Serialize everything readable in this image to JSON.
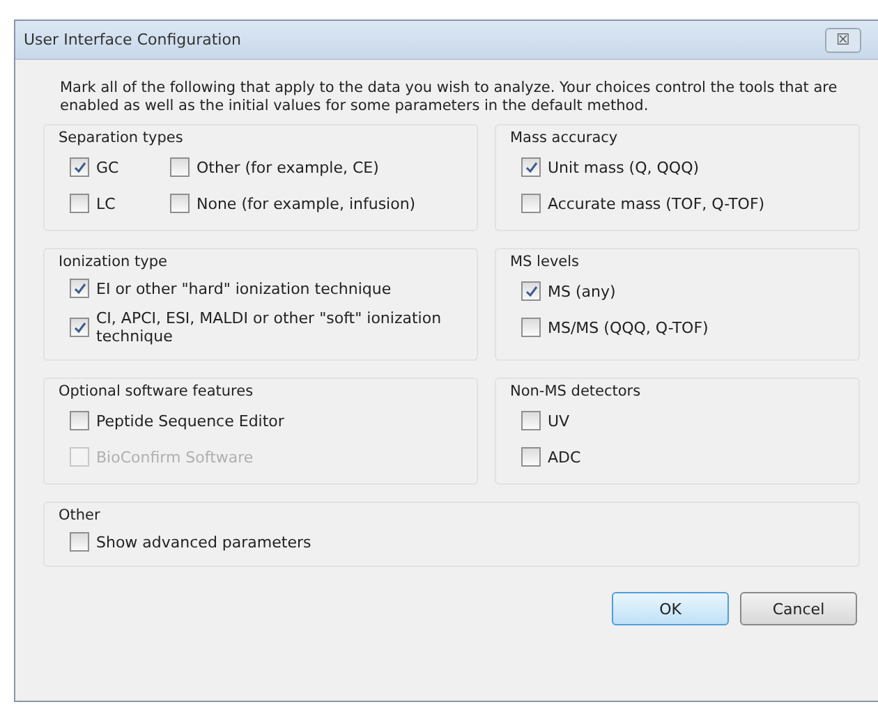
{
  "window": {
    "title": "User Interface Configuration",
    "close": "☒"
  },
  "intro": "Mark all of the following that apply to the data you wish to analyze. Your choices control the tools that are enabled as well as the initial values for some parameters in the default method.",
  "rows": [
    [
      {
        "title": "Separation types",
        "kind": "grid",
        "items": [
          {
            "label": "GC",
            "checked": true,
            "disabled": false
          },
          {
            "label": "Other (for example, CE)",
            "checked": false,
            "disabled": false
          },
          {
            "label": "LC",
            "checked": false,
            "disabled": false
          },
          {
            "label": "None (for example, infusion)",
            "checked": false,
            "disabled": false
          }
        ]
      },
      {
        "title": "Mass accuracy",
        "kind": "list",
        "items": [
          {
            "label": "Unit mass  (Q, QQQ)",
            "checked": true,
            "disabled": false
          },
          {
            "label": "Accurate mass  (TOF, Q-TOF)",
            "checked": false,
            "disabled": false
          }
        ]
      }
    ],
    [
      {
        "title": "Ionization type",
        "kind": "list",
        "items": [
          {
            "label": "EI or other \"hard\" ionization technique",
            "checked": true,
            "disabled": false
          },
          {
            "label": "CI, APCI, ESI, MALDI or other \"soft\" ionization technique",
            "checked": true,
            "disabled": false
          }
        ]
      },
      {
        "title": "MS levels",
        "kind": "list",
        "items": [
          {
            "label": "MS  (any)",
            "checked": true,
            "disabled": false
          },
          {
            "label": "MS/MS  (QQQ, Q-TOF)",
            "checked": false,
            "disabled": false
          }
        ]
      }
    ],
    [
      {
        "title": "Optional software features",
        "kind": "list",
        "items": [
          {
            "label": "Peptide Sequence Editor",
            "checked": false,
            "disabled": false
          },
          {
            "label": "BioConfirm Software",
            "checked": false,
            "disabled": true
          }
        ]
      },
      {
        "title": "Non-MS detectors",
        "kind": "list",
        "items": [
          {
            "label": "UV",
            "checked": false,
            "disabled": false
          },
          {
            "label": "ADC",
            "checked": false,
            "disabled": false
          }
        ]
      }
    ]
  ],
  "other": {
    "title": "Other",
    "items": [
      {
        "label": "Show advanced parameters",
        "checked": false,
        "disabled": false
      }
    ]
  },
  "buttons": [
    {
      "label": "OK",
      "default": true
    },
    {
      "label": "Cancel",
      "default": false
    }
  ]
}
